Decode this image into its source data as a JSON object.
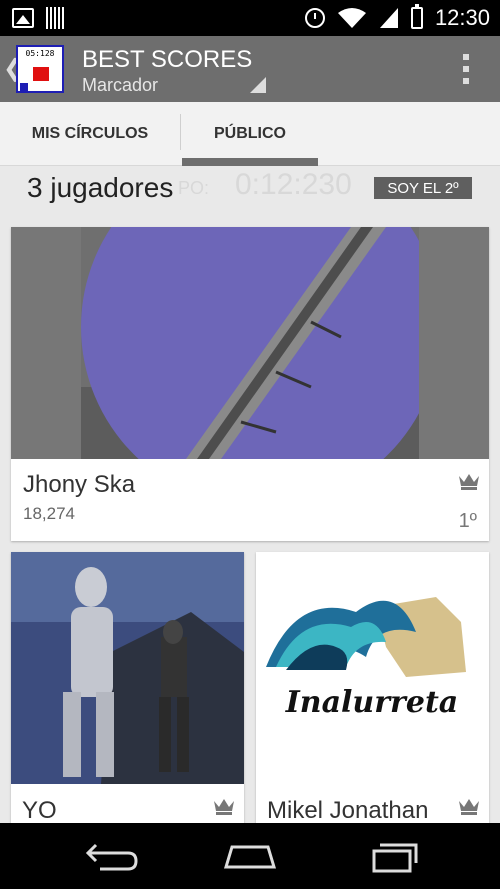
{
  "status_bar": {
    "time": "12:30",
    "icons": [
      "image-icon",
      "barcode-icon",
      "alarm-icon",
      "wifi-icon",
      "signal-icon",
      "battery-icon"
    ]
  },
  "action_bar": {
    "app_icon_text": "05:128",
    "title": "BEST SCORES",
    "subtitle": "Marcador"
  },
  "tabs": [
    {
      "label": "MIS CÍRCULOS"
    },
    {
      "label": "PÚBLICO"
    }
  ],
  "header": {
    "players_count": "3 jugadores",
    "ghost_label": "PO:",
    "ghost_time": "0:12:230",
    "rank_badge": "SOY EL 2º"
  },
  "players": [
    {
      "name": "Jhony Ska",
      "score": "18,274",
      "rank": "1º"
    },
    {
      "name": "YO"
    },
    {
      "name": "Mikel Jonathan",
      "logo_text": "Inalurreta"
    }
  ],
  "colors": {
    "action_bar": "#6e6e6e",
    "background": "#e9e9e9",
    "rank_badge": "#5f5f5f"
  }
}
